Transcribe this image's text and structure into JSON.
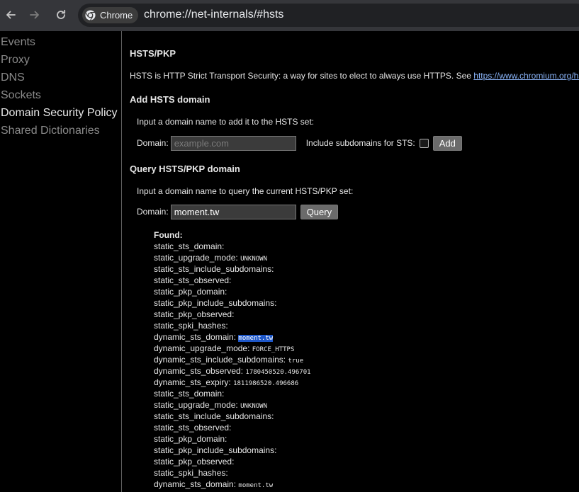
{
  "browser": {
    "chip_label": "Chrome",
    "url": "chrome://net-internals/#hsts",
    "back_icon": "arrow-left-icon",
    "forward_icon": "arrow-right-icon",
    "reload_icon": "reload-icon"
  },
  "sidebar": {
    "items": [
      {
        "label": "Events"
      },
      {
        "label": "Proxy"
      },
      {
        "label": "DNS"
      },
      {
        "label": "Sockets"
      },
      {
        "label": "Domain Security Policy"
      },
      {
        "label": "Shared Dictionaries"
      }
    ],
    "active_item": "Domain Security Policy"
  },
  "main": {
    "title": "HSTS/PKP",
    "description": "HSTS is HTTP Strict Transport Security: a way for sites to elect to always use HTTPS. See ",
    "description_link": "https://www.chromium.org/hsts",
    "description_end": ".",
    "add": {
      "heading": "Add HSTS domain",
      "instruction": "Input a domain name to add it to the HSTS set:",
      "domain_label": "Domain:",
      "domain_placeholder": "example.com",
      "domain_value": "",
      "subdomains_label": "Include subdomains for STS:",
      "button_label": "Add"
    },
    "query": {
      "heading": "Query HSTS/PKP domain",
      "instruction": "Input a domain name to query the current HSTS/PKP set:",
      "domain_label": "Domain:",
      "domain_value": "moment.tw",
      "button_label": "Query"
    },
    "results": {
      "found_label": "Found:",
      "lines": [
        {
          "key": "static_sts_domain:",
          "value": ""
        },
        {
          "key": "static_upgrade_mode:",
          "value": "UNKNOWN"
        },
        {
          "key": "static_sts_include_subdomains:",
          "value": ""
        },
        {
          "key": "static_sts_observed:",
          "value": ""
        },
        {
          "key": "static_pkp_domain:",
          "value": ""
        },
        {
          "key": "static_pkp_include_subdomains:",
          "value": ""
        },
        {
          "key": "static_pkp_observed:",
          "value": ""
        },
        {
          "key": "static_spki_hashes:",
          "value": ""
        },
        {
          "key": "dynamic_sts_domain:",
          "value": "moment.tw"
        },
        {
          "key": "dynamic_upgrade_mode:",
          "value": "FORCE_HTTPS"
        },
        {
          "key": "dynamic_sts_include_subdomains:",
          "value": "true"
        },
        {
          "key": "dynamic_sts_observed:",
          "value": "1780450520.496701"
        },
        {
          "key": "dynamic_sts_expiry:",
          "value": "1811986520.496686"
        },
        {
          "key": "static_sts_domain:",
          "value": ""
        },
        {
          "key": "static_upgrade_mode:",
          "value": "UNKNOWN"
        },
        {
          "key": "static_sts_include_subdomains:",
          "value": ""
        },
        {
          "key": "static_sts_observed:",
          "value": ""
        },
        {
          "key": "static_pkp_domain:",
          "value": ""
        },
        {
          "key": "static_pkp_include_subdomains:",
          "value": ""
        },
        {
          "key": "static_pkp_observed:",
          "value": ""
        },
        {
          "key": "static_spki_hashes:",
          "value": ""
        },
        {
          "key": "dynamic_sts_domain:",
          "value": "moment.tw"
        }
      ]
    }
  }
}
